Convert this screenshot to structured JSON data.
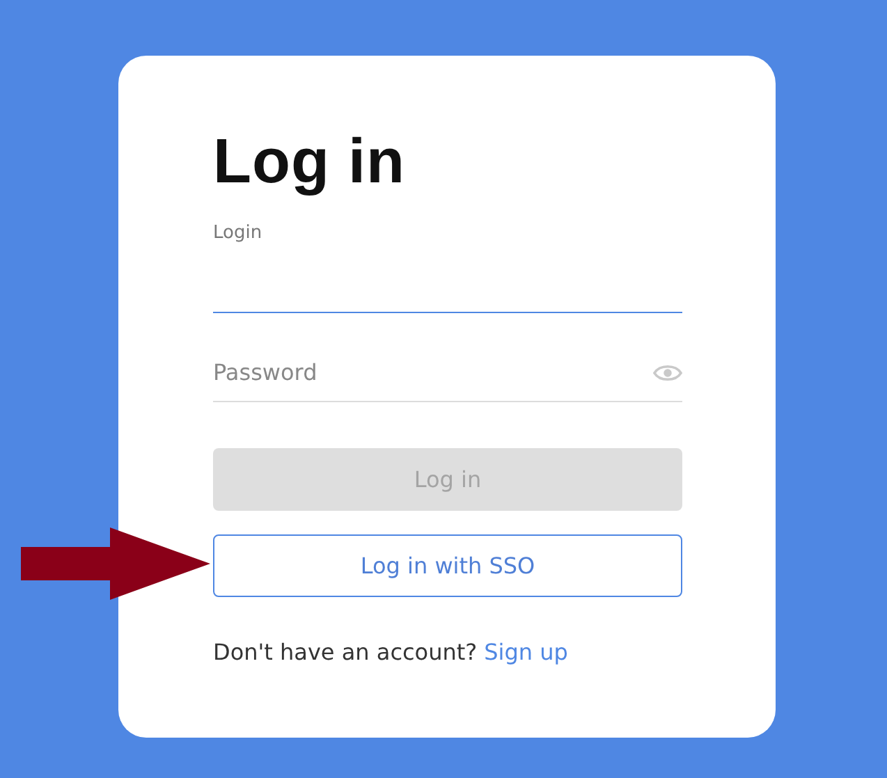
{
  "title": "Log in",
  "fields": [
    {
      "label": "Login",
      "focused": true,
      "password": false
    },
    {
      "placeholder": "Password",
      "focused": false,
      "password": true
    }
  ],
  "buttons": [
    {
      "label": "Log in",
      "kind": "primary",
      "disabled": true
    },
    {
      "label": "Log in with SSO",
      "kind": "outline",
      "disabled": false
    }
  ],
  "footer": {
    "text": "Don't have an account?",
    "link": "Sign up"
  },
  "annotation": {
    "kind": "arrow"
  }
}
